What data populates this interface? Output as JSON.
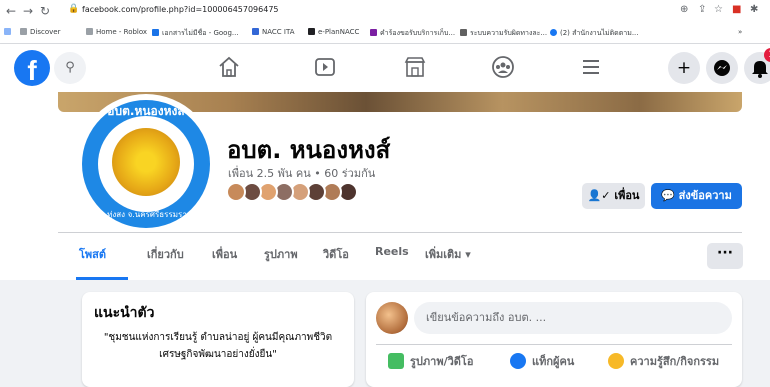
{
  "browser": {
    "url": "facebook.com/profile.php?id=100006457096475",
    "bookmarks": [
      "Discover",
      "Home - Roblox",
      "เอกสารไม่มีชื่อ - Goog...",
      "NACC ITA",
      "e-PlanNACC",
      "คำร้องขอรับบริการเก็บ...",
      "ระบบความรับผิดทางละ...",
      "(2) สำนักงานไม่ติดตาม..."
    ]
  },
  "profile": {
    "name": "อบต. หนองหงส์",
    "followers": "เพื่อน 2.5 พัน คน • 60 ร่วมกัน",
    "avatar_text_top": "อบต.หนองหงส์",
    "avatar_text_bottom": "อ.ทุ่งสง จ.นครศรีธรรมราช",
    "friend_button": "เพื่อน",
    "message_button": "ส่งข้อความ",
    "friend_avatar_colors": [
      "#c78a5a",
      "#6d4c41",
      "#e0a26f",
      "#8d6e63",
      "#d5a07a",
      "#5d4037",
      "#b07c57",
      "#4e342e"
    ]
  },
  "tabs": [
    "โพสต์",
    "เกี่ยวกับ",
    "เพื่อน",
    "รูปภาพ",
    "วิดีโอ",
    "Reels",
    "เพิ่มเติม ▾"
  ],
  "more_label": "···",
  "intro": {
    "title": "แนะนำตัว",
    "bio": "\"ชุมชนแห่งการเรียนรู้ ตำบลน่าอยู่ ผู้คนมีคุณภาพชีวิต เศรษฐกิจพัฒนาอย่างยั่งยืน\""
  },
  "composer": {
    "placeholder": "เขียนข้อความถึง อบต. ...",
    "actions": [
      "รูปภาพ/วิดีโอ",
      "แท็กผู้คน",
      "ความรู้สึก/กิจกรรม"
    ]
  },
  "notif_count": "1",
  "colors": {
    "brand": "#1877f2",
    "message_button": "#1b74e4"
  }
}
